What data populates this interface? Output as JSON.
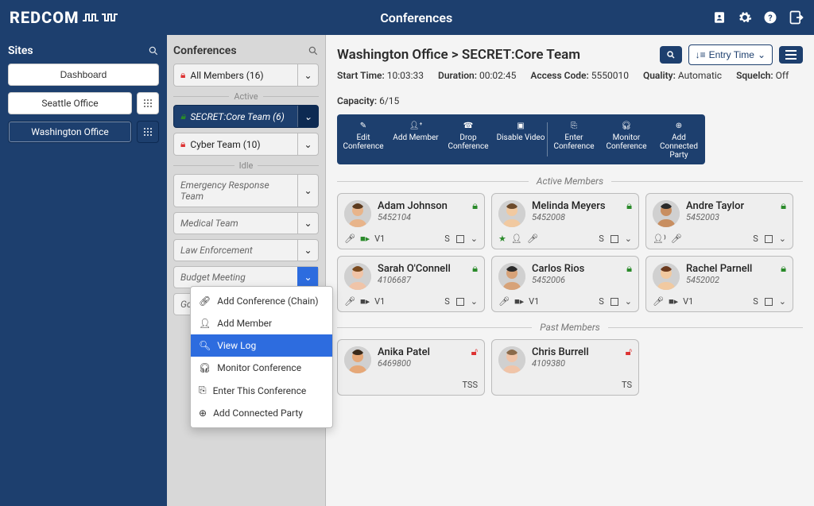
{
  "header": {
    "brand": "REDCOM",
    "title": "Conferences"
  },
  "sites": {
    "title": "Sites",
    "dashboard": "Dashboard",
    "items": [
      {
        "label": "Seattle Office",
        "active": false
      },
      {
        "label": "Washington Office",
        "active": true
      }
    ]
  },
  "conferencesPanel": {
    "title": "Conferences",
    "allMembers": "All Members (16)",
    "activeLabel": "Active",
    "idleLabel": "Idle",
    "active": [
      {
        "label": "SECRET:Core Team (6)",
        "selected": true,
        "lock": "green"
      },
      {
        "label": "Cyber Team (10)",
        "lock": "red"
      }
    ],
    "idle": [
      {
        "label": "Emergency Response Team"
      },
      {
        "label": "Medical Team"
      },
      {
        "label": "Law Enforcement"
      },
      {
        "label": "Budget Meeting",
        "menuOpen": true
      },
      {
        "label": "Go"
      }
    ],
    "menu": {
      "addChain": "Add Conference (Chain)",
      "addMember": "Add Member",
      "viewLog": "View Log",
      "monitor": "Monitor Conference",
      "enter": "Enter This Conference",
      "addParty": "Add Connected Party"
    }
  },
  "main": {
    "breadcrumb": "Washington Office > SECRET:Core Team",
    "sort": "Entry Time",
    "meta": {
      "startTimeLabel": "Start Time:",
      "startTime": "10:03:33",
      "durationLabel": "Duration:",
      "duration": "00:02:45",
      "accessCodeLabel": "Access Code:",
      "accessCode": "5550010",
      "qualityLabel": "Quality:",
      "quality": "Automatic",
      "squelchLabel": "Squelch:",
      "squelch": "Off",
      "capacityLabel": "Capacity:",
      "capacity": "6/15"
    },
    "actions": {
      "edit": "Edit Conference",
      "addMember": "Add Member",
      "drop": "Drop Conference",
      "disableVideo": "Disable Video",
      "enter": "Enter Conference",
      "monitor": "Monitor Conference",
      "addParty": "Add Connected Party"
    },
    "activeMembersLabel": "Active Members",
    "pastMembersLabel": "Past Members",
    "activeMembers": [
      {
        "name": "Adam Johnson",
        "number": "5452104",
        "v": "V1",
        "s": "S",
        "icons": [
          "mic",
          "video-green"
        ]
      },
      {
        "name": "Melinda Meyers",
        "number": "5452008",
        "v": "",
        "s": "S",
        "icons": [
          "star",
          "person",
          "mic"
        ]
      },
      {
        "name": "Andre Taylor",
        "number": "5452003",
        "v": "",
        "s": "S",
        "icons": [
          "person-sound",
          "mic"
        ]
      },
      {
        "name": "Sarah O'Connell",
        "number": "4106687",
        "v": "V1",
        "s": "S",
        "icons": [
          "mic",
          "video"
        ]
      },
      {
        "name": "Carlos Rios",
        "number": "5452006",
        "v": "V1",
        "s": "S",
        "icons": [
          "mic",
          "video"
        ]
      },
      {
        "name": "Rachel Parnell",
        "number": "5452002",
        "v": "V1",
        "s": "S",
        "icons": [
          "mic",
          "video"
        ]
      }
    ],
    "pastMembers": [
      {
        "name": "Anika Patel",
        "number": "6469800",
        "tag": "TSS"
      },
      {
        "name": "Chris Burrell",
        "number": "4109380",
        "tag": "TS"
      }
    ]
  }
}
